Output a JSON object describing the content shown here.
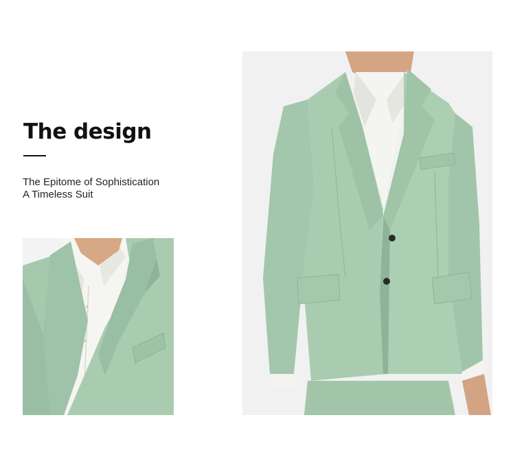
{
  "heading": {
    "title": "The design"
  },
  "tagline": {
    "line1": "The Epitome of Sophistication",
    "line2": "A Timeless Suit"
  },
  "colors": {
    "suit_mint": "#a9ccb1",
    "suit_shadow": "#8fb399",
    "shirt_white": "#f4f4f0",
    "skin": "#d2a483",
    "background": "#ffffff",
    "text": "#111111"
  }
}
